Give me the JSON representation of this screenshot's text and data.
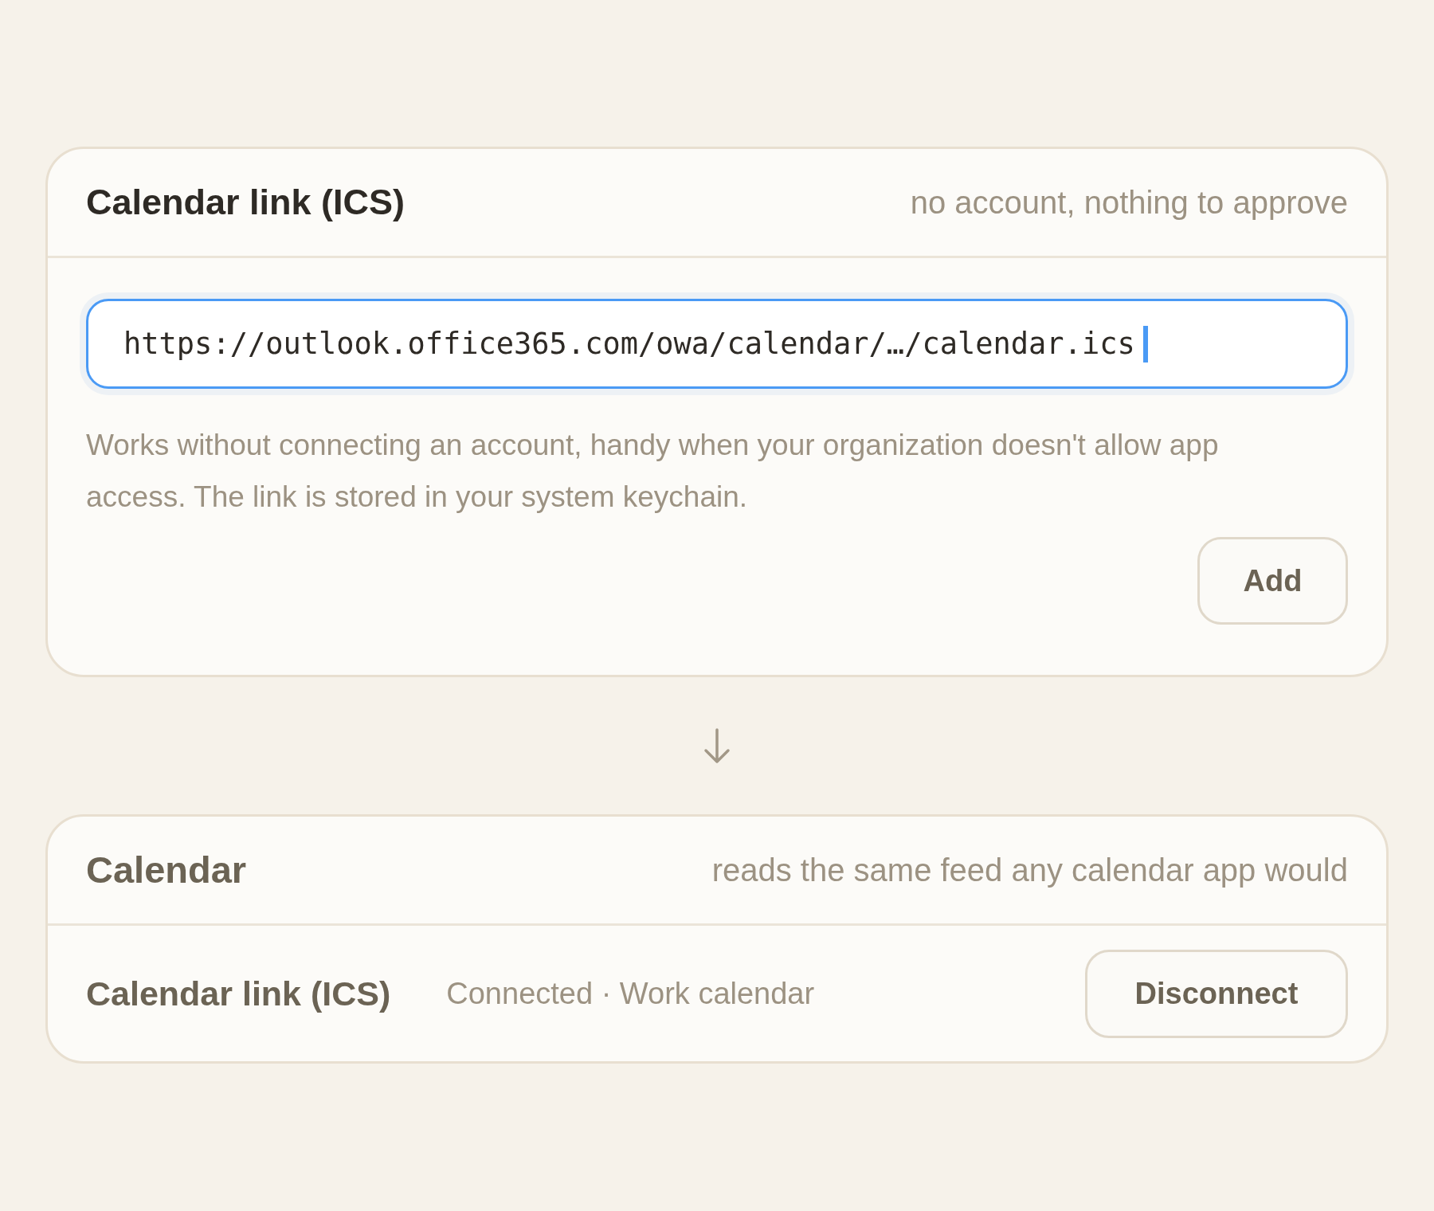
{
  "source_card": {
    "title": "Calendar link (ICS)",
    "subtitle": "no account, nothing to approve",
    "url_field": {
      "value": "https://outlook.office365.com/owa/calendar/…/calendar.ics",
      "focused": true
    },
    "help_text": "Works without connecting an account, handy when your organization doesn't allow app access. The link is stored in your system keychain.",
    "button": "Add"
  },
  "target_card": {
    "title": "Calendar",
    "subtitle": "reads the same feed any calendar app would",
    "connection": {
      "name": "Calendar link (ICS)",
      "status": "Connected · Work calendar",
      "button": "Disconnect"
    }
  }
}
